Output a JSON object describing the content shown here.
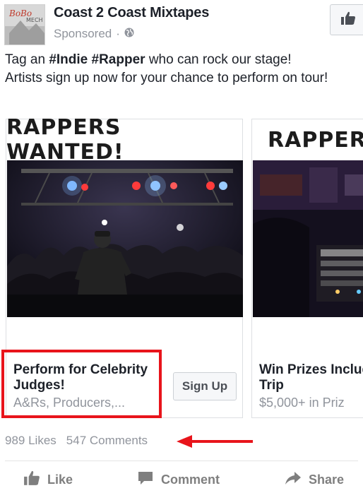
{
  "page": {
    "name": "Coast 2 Coast Mixtapes",
    "sponsored": "Sponsored",
    "separator": "·"
  },
  "post": {
    "line1_prefix": "Tag an ",
    "hashtag1": "#Indie",
    "hashtag2": "#Rapper",
    "line1_suffix": " who can rock our stage!",
    "line2": "Artists sign up now for your chance to perform on tour!"
  },
  "carousel": {
    "cards": [
      {
        "headline": "RAPPERS WANTED!",
        "title": "Perform for Celebrity Judges!",
        "subtitle": "A&Rs, Producers,...",
        "cta": "Sign Up"
      },
      {
        "headline": "RAPPERS",
        "title": "Win Prizes Including Trip",
        "subtitle": "$5,000+ in Priz"
      }
    ]
  },
  "stats": {
    "likes": "989 Likes",
    "comments": "547 Comments"
  },
  "actions": {
    "like": "Like",
    "comment": "Comment",
    "share": "Share"
  },
  "colors": {
    "highlight": "#e8141b",
    "muted_text": "#90949c",
    "action_text": "#7f7f7f"
  },
  "icons": [
    "thumbs-up-icon",
    "globe-icon",
    "comment-icon",
    "share-icon",
    "arrow-left-icon"
  ]
}
